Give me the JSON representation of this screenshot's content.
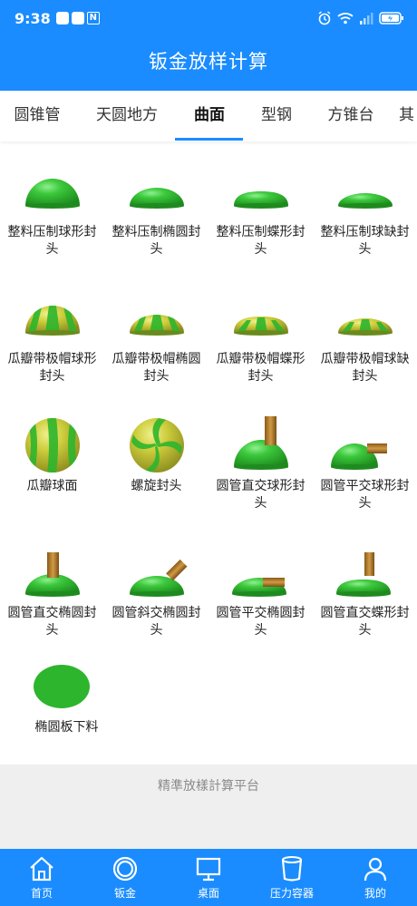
{
  "status": {
    "time": "9:38",
    "n_badge": "N"
  },
  "app": {
    "title": "钣金放样计算"
  },
  "tabs": [
    {
      "label": "圆锥管"
    },
    {
      "label": "天圆地方"
    },
    {
      "label": "曲面"
    },
    {
      "label": "型钢"
    },
    {
      "label": "方锥台"
    },
    {
      "label": "其"
    }
  ],
  "items": [
    {
      "label": "整料压制球形封头",
      "icon": "dome-hemisphere-icon"
    },
    {
      "label": "整料压制椭圆封头",
      "icon": "dome-ellipsoidal-icon"
    },
    {
      "label": "整料压制蝶形封头",
      "icon": "dome-dished-icon"
    },
    {
      "label": "整料压制球缺封头",
      "icon": "dome-segment-icon"
    },
    {
      "label": "瓜瓣带极帽球形封头",
      "icon": "petal-hemisphere-icon"
    },
    {
      "label": "瓜瓣带极帽椭圆封头",
      "icon": "petal-ellipsoidal-icon"
    },
    {
      "label": "瓜瓣带极帽蝶形封头",
      "icon": "petal-dished-icon"
    },
    {
      "label": "瓜瓣带极帽球缺封头",
      "icon": "petal-segment-icon"
    },
    {
      "label": "瓜瓣球面",
      "icon": "petal-sphere-icon"
    },
    {
      "label": "螺旋封头",
      "icon": "spiral-head-icon"
    },
    {
      "label": "圆管直交球形封头",
      "icon": "pipe-vertical-hemisphere-icon"
    },
    {
      "label": "圆管平交球形封头",
      "icon": "pipe-horizontal-hemisphere-icon"
    },
    {
      "label": "圆管直交椭圆封头",
      "icon": "pipe-vertical-ellipsoidal-icon"
    },
    {
      "label": "圆管斜交椭圆封头",
      "icon": "pipe-oblique-ellipsoidal-icon"
    },
    {
      "label": "圆管平交椭圆封头",
      "icon": "pipe-horizontal-ellipsoidal-icon"
    },
    {
      "label": "圆管直交蝶形封头",
      "icon": "pipe-vertical-dished-icon"
    },
    {
      "label": "椭圆板下料",
      "icon": "ellipse-plate-icon"
    }
  ],
  "footer": {
    "text": "精準放樣計算平台"
  },
  "nav": [
    {
      "label": "首页",
      "icon": "home-icon"
    },
    {
      "label": "钣金",
      "icon": "sheet-metal-icon"
    },
    {
      "label": "桌面",
      "icon": "monitor-icon"
    },
    {
      "label": "压力容器",
      "icon": "container-icon"
    },
    {
      "label": "我的",
      "icon": "user-icon"
    }
  ],
  "colors": {
    "primary": "#1a8cff",
    "dome_green": "#2db52d",
    "petal_yellow": "#c8c83c",
    "pipe_brown": "#b07a2a"
  }
}
